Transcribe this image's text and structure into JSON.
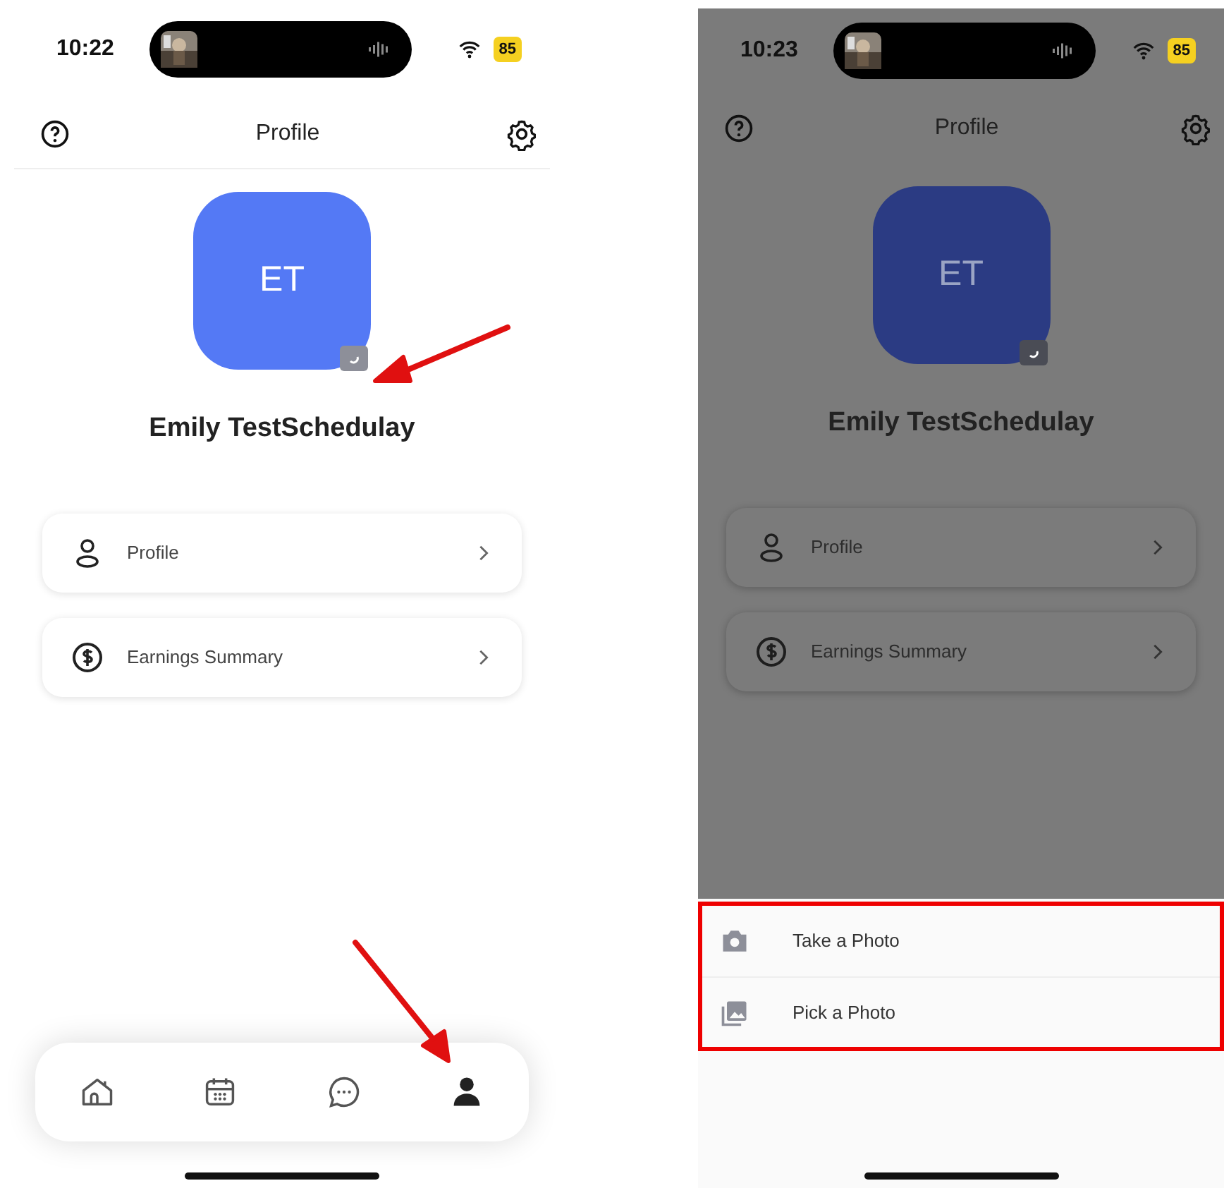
{
  "screens": [
    {
      "dimmed": false,
      "status_bar": {
        "time": "10:22",
        "battery": "85"
      },
      "header": {
        "title": "Profile"
      },
      "avatar": {
        "initials": "ET"
      },
      "user_name": "Emily TestSchedulay",
      "menu": [
        {
          "kind": "person",
          "label": "Profile"
        },
        {
          "kind": "dollar",
          "label": "Earnings Summary"
        }
      ],
      "tab_bar": [
        {
          "kind": "home",
          "selected": false
        },
        {
          "kind": "calendar",
          "selected": false
        },
        {
          "kind": "chat",
          "selected": false
        },
        {
          "kind": "person",
          "selected": true
        }
      ]
    },
    {
      "dimmed": true,
      "status_bar": {
        "time": "10:23",
        "battery": "85"
      },
      "header": {
        "title": "Profile"
      },
      "avatar": {
        "initials": "ET"
      },
      "user_name": "Emily TestSchedulay",
      "menu": [
        {
          "kind": "person",
          "label": "Profile"
        },
        {
          "kind": "dollar",
          "label": "Earnings Summary"
        }
      ],
      "sheet": [
        {
          "kind": "camera",
          "label": "Take a Photo"
        },
        {
          "kind": "gallery",
          "label": "Pick a Photo"
        }
      ]
    }
  ]
}
